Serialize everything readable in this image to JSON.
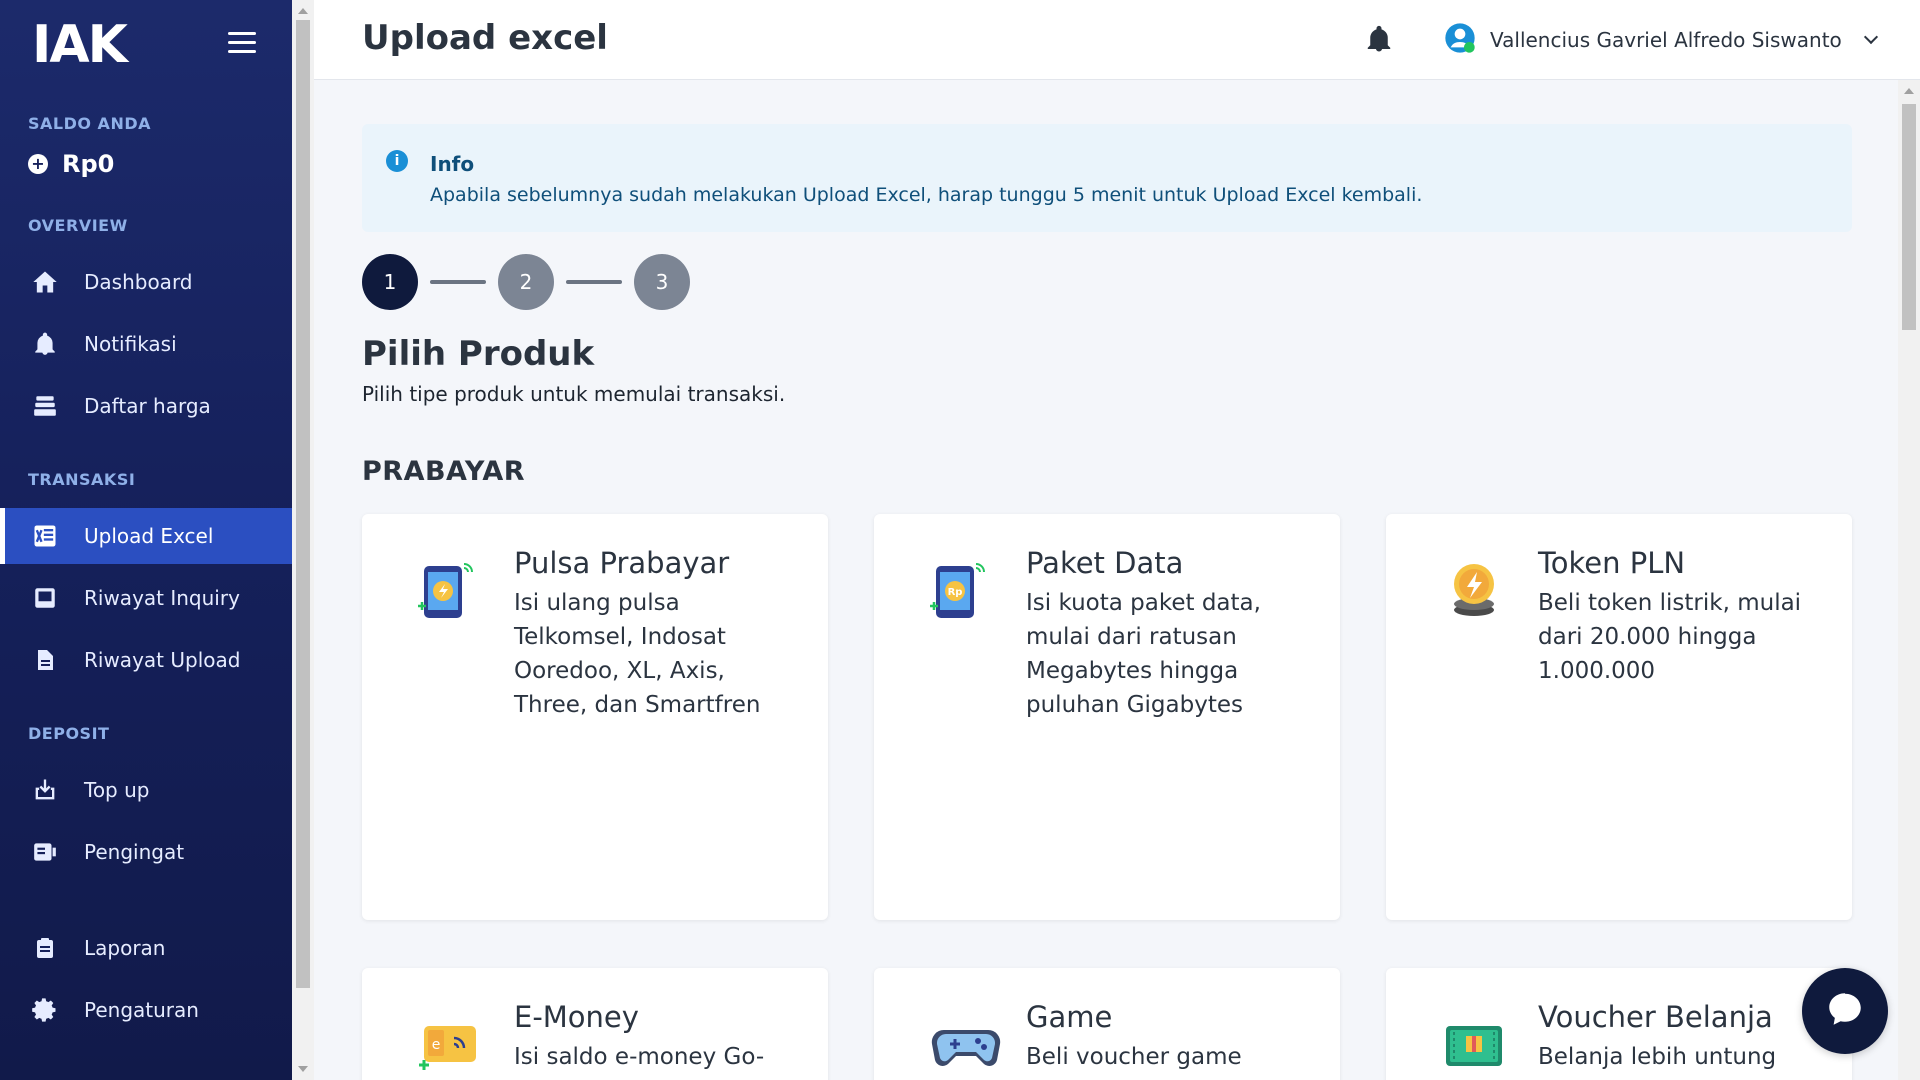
{
  "brand": {
    "logo_text": "IAK"
  },
  "sidebar": {
    "balance_label": "SALDO ANDA",
    "balance_value": "Rp0",
    "sections": {
      "overview": "OVERVIEW",
      "transaksi": "TRANSAKSI",
      "deposit": "DEPOSIT"
    },
    "items": [
      {
        "label": "Dashboard",
        "icon": "home-icon"
      },
      {
        "label": "Notifikasi",
        "icon": "bell-icon"
      },
      {
        "label": "Daftar harga",
        "icon": "price-stack-icon"
      },
      {
        "label": "Upload Excel",
        "icon": "excel-icon",
        "active": true
      },
      {
        "label": "Riwayat Inquiry",
        "icon": "inbox-icon"
      },
      {
        "label": "Riwayat Upload",
        "icon": "document-icon"
      },
      {
        "label": "Top up",
        "icon": "topup-icon"
      },
      {
        "label": "Pengingat",
        "icon": "reminder-icon"
      },
      {
        "label": "Laporan",
        "icon": "clipboard-icon"
      },
      {
        "label": "Pengaturan",
        "icon": "gear-icon"
      }
    ]
  },
  "header": {
    "title": "Upload excel",
    "user_name": "Vallencius Gavriel Alfredo Siswanto"
  },
  "info": {
    "title": "Info",
    "text": "Apabila sebelumnya sudah melakukan Upload Excel, harap tunggu 5 menit untuk Upload Excel kembali."
  },
  "stepper": {
    "steps": [
      "1",
      "2",
      "3"
    ],
    "current": 1
  },
  "main": {
    "section_title": "Pilih Produk",
    "section_subtitle": "Pilih tipe produk untuk memulai transaksi.",
    "group_title": "PRABAYAR",
    "cards": [
      {
        "title": "Pulsa Prabayar",
        "desc": "Isi ulang pulsa Telkomsel, Indosat Ooredoo, XL, Axis, Three, dan Smartfren",
        "icon": "phone-credit-icon"
      },
      {
        "title": "Paket Data",
        "desc": "Isi kuota paket data, mulai dari ratusan Megabytes hingga puluhan Gigabytes",
        "icon": "phone-data-icon"
      },
      {
        "title": "Token PLN",
        "desc": "Beli token listrik, mulai dari 20.000 hingga 1.000.000",
        "icon": "coin-lightning-icon"
      },
      {
        "title": "E-Money",
        "desc": "Isi saldo e-money Go-",
        "icon": "emoney-card-icon"
      },
      {
        "title": "Game",
        "desc": "Beli voucher game",
        "icon": "gamepad-icon"
      },
      {
        "title": "Voucher Belanja",
        "desc": "Belanja lebih untung",
        "icon": "gift-voucher-icon"
      }
    ]
  },
  "colors": {
    "sidebar_bg": "#15205a",
    "active_item": "#2b4fc1",
    "step_active": "#0f1a3d",
    "info_bg": "#eaf4fb"
  }
}
